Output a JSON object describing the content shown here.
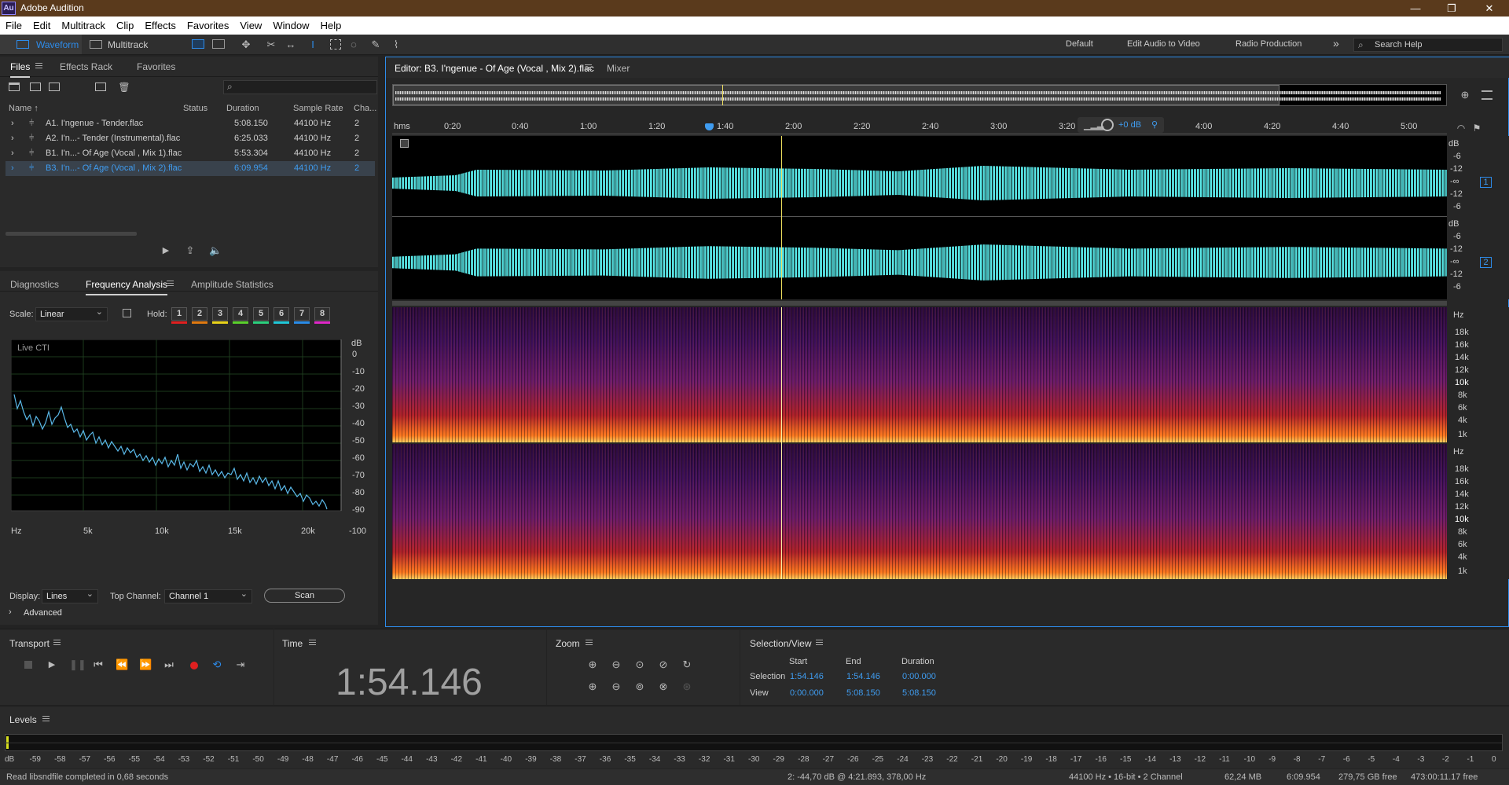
{
  "app": {
    "logo": "Au",
    "title": "Adobe Audition"
  },
  "window_controls": {
    "minimize": "—",
    "maximize": "❐",
    "close": "✕"
  },
  "menu": [
    "File",
    "Edit",
    "Multitrack",
    "Clip",
    "Effects",
    "Favorites",
    "View",
    "Window",
    "Help"
  ],
  "toolbar": {
    "waveform": "Waveform",
    "multitrack": "Multitrack",
    "workspaces": [
      "Default",
      "Edit Audio to Video",
      "Radio Production"
    ],
    "more": "»",
    "search_placeholder": "Search Help"
  },
  "files_panel": {
    "tabs": [
      "Files",
      "Effects Rack",
      "Favorites"
    ],
    "columns": [
      "Name ↑",
      "Status",
      "Duration",
      "Sample Rate",
      "Cha..."
    ],
    "rows": [
      {
        "name": "A1. I'ngenue - Tender.flac",
        "duration": "5:08.150",
        "rate": "44100 Hz",
        "ch": "2"
      },
      {
        "name": "A2. I'n...- Tender (Instrumental).flac",
        "duration": "6:25.033",
        "rate": "44100 Hz",
        "ch": "2"
      },
      {
        "name": "B1. I'n...- Of Age (Vocal , Mix 1).flac",
        "duration": "5:53.304",
        "rate": "44100 Hz",
        "ch": "2"
      },
      {
        "name": "B3. I'n...- Of Age (Vocal , Mix 2).flac",
        "duration": "6:09.954",
        "rate": "44100 Hz",
        "ch": "2"
      }
    ]
  },
  "analysis_panel": {
    "tabs": [
      "Diagnostics",
      "Frequency Analysis",
      "Amplitude Statistics"
    ],
    "scale_label": "Scale:",
    "scale_value": "Linear",
    "hold_label": "Hold:",
    "holds": [
      "1",
      "2",
      "3",
      "4",
      "5",
      "6",
      "7",
      "8"
    ],
    "hold_colors": [
      "#e02020",
      "#e07a10",
      "#e8d21a",
      "#5bd02c",
      "#2bd07e",
      "#20c8d8",
      "#2a8ce8",
      "#e028c8"
    ],
    "graph_label": "Live CTI",
    "db_unit": "dB",
    "db_ticks": [
      "0",
      "-10",
      "-20",
      "-30",
      "-40",
      "-50",
      "-60",
      "-70",
      "-80",
      "-90",
      "-100"
    ],
    "hz_ticks": [
      "Hz",
      "5k",
      "10k",
      "15k",
      "20k"
    ],
    "display_label": "Display:",
    "display_value": "Lines",
    "top_channel_label": "Top Channel:",
    "top_channel_value": "Channel 1",
    "scan_button": "Scan",
    "advanced": "Advanced"
  },
  "editor": {
    "tab_title": "Editor: B3. I'ngenue - Of Age (Vocal , Mix 2).flac",
    "mixer_tab": "Mixer",
    "timeline_unit": "hms",
    "timeline": [
      "0:20",
      "0:40",
      "1:00",
      "1:20",
      "1:40",
      "2:00",
      "2:20",
      "2:40",
      "3:00",
      "3:20",
      "4:00",
      "4:20",
      "4:40",
      "5:00"
    ],
    "hud_gain": "+0 dB",
    "wave_db_labels": [
      "dB",
      "-6",
      "-12",
      "-∞",
      "-12",
      "-6"
    ],
    "channel_badges": [
      "1",
      "2"
    ],
    "spec_labels": [
      "Hz",
      "18k",
      "16k",
      "14k",
      "12k",
      "10k",
      "8k",
      "6k",
      "4k",
      "1k"
    ]
  },
  "transport": {
    "title": "Transport"
  },
  "time": {
    "title": "Time",
    "value": "1:54.146"
  },
  "zoom": {
    "title": "Zoom"
  },
  "selection": {
    "title": "Selection/View",
    "headers": [
      "Start",
      "End",
      "Duration"
    ],
    "selection_label": "Selection",
    "selection": [
      "1:54.146",
      "1:54.146",
      "0:00.000"
    ],
    "view_label": "View",
    "view": [
      "0:00.000",
      "5:08.150",
      "5:08.150"
    ]
  },
  "levels": {
    "title": "Levels",
    "scale": [
      "dB",
      "-59",
      "-58",
      "-57",
      "-56",
      "-55",
      "-54",
      "-53",
      "-52",
      "-51",
      "-50",
      "-49",
      "-48",
      "-47",
      "-46",
      "-45",
      "-44",
      "-43",
      "-42",
      "-41",
      "-40",
      "-39",
      "-38",
      "-37",
      "-36",
      "-35",
      "-34",
      "-33",
      "-32",
      "-31",
      "-30",
      "-29",
      "-28",
      "-27",
      "-26",
      "-25",
      "-24",
      "-23",
      "-22",
      "-21",
      "-20",
      "-19",
      "-18",
      "-17",
      "-16",
      "-15",
      "-14",
      "-13",
      "-12",
      "-11",
      "-10",
      "-9",
      "-8",
      "-7",
      "-6",
      "-5",
      "-4",
      "-3",
      "-2",
      "-1",
      "0"
    ]
  },
  "status": {
    "left": "Read libsndfile completed in 0,68 seconds",
    "info": "2: -44,70 dB @ 4:21.893, 378,00 Hz",
    "format": "44100 Hz • 16-bit • 2 Channel",
    "size": "62,24 MB",
    "duration": "6:09.954",
    "free": "279,75 GB free",
    "time_free": "473:00:11.17 free"
  },
  "colors": {
    "accent": "#2d8ceb",
    "waveform": "#5ee8e8",
    "cti": "#f0e060",
    "titlebar": "#5a3a1c"
  }
}
